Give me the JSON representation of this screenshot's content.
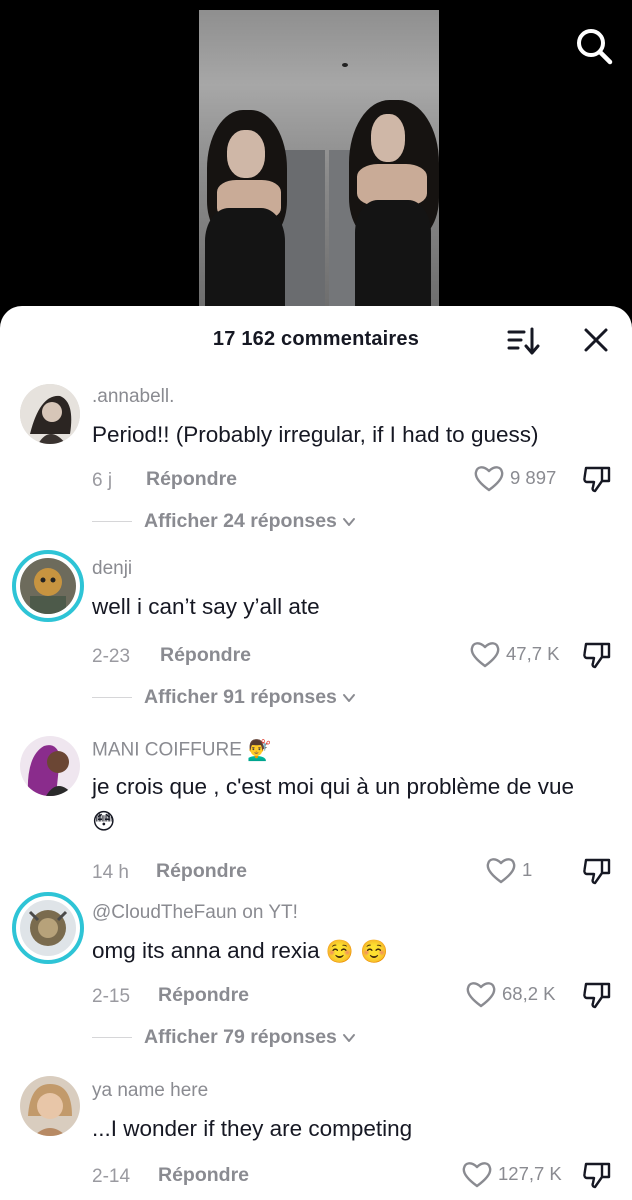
{
  "header": {
    "comment_count_label": "17 162 commentaires"
  },
  "icons": {
    "search": "search-icon",
    "sort": "sort-icon",
    "close": "close-icon",
    "heart": "heart-icon",
    "dislike": "dislike-icon"
  },
  "colors": {
    "text_primary": "#161823",
    "text_secondary": "#8a8b91",
    "story_ring": "#2ec4d6"
  },
  "comments": [
    {
      "username": ".annabell.",
      "text": "Period!! (Probably irregular, if I had to guess)",
      "date": "6 j",
      "reply_label": "Répondre",
      "likes": "9 897",
      "view_replies": "Afficher 24 réponses"
    },
    {
      "username": "denji",
      "text": "well i can’t say y’all ate",
      "date": "2-23",
      "reply_label": "Répondre",
      "likes": "47,7 K",
      "view_replies": "Afficher 91 réponses"
    },
    {
      "username": "MANI COIFFURE",
      "username_emoji": "💇‍♂️",
      "text": "je crois que , c'est moi qui à un problème de vue",
      "text_emoji": "😳",
      "date": "14 h",
      "reply_label": "Répondre",
      "likes": "1"
    },
    {
      "username": "@CloudTheFaun on YT!",
      "text": "omg its anna and rexia",
      "text_emoji": "☺️ ☺️",
      "date": "2-15",
      "reply_label": "Répondre",
      "likes": "68,2 K",
      "view_replies": "Afficher 79 réponses"
    },
    {
      "username": "ya name here",
      "text": "...I wonder if they are competing",
      "date": "2-14",
      "reply_label": "Répondre",
      "likes": "127,7 K"
    }
  ]
}
